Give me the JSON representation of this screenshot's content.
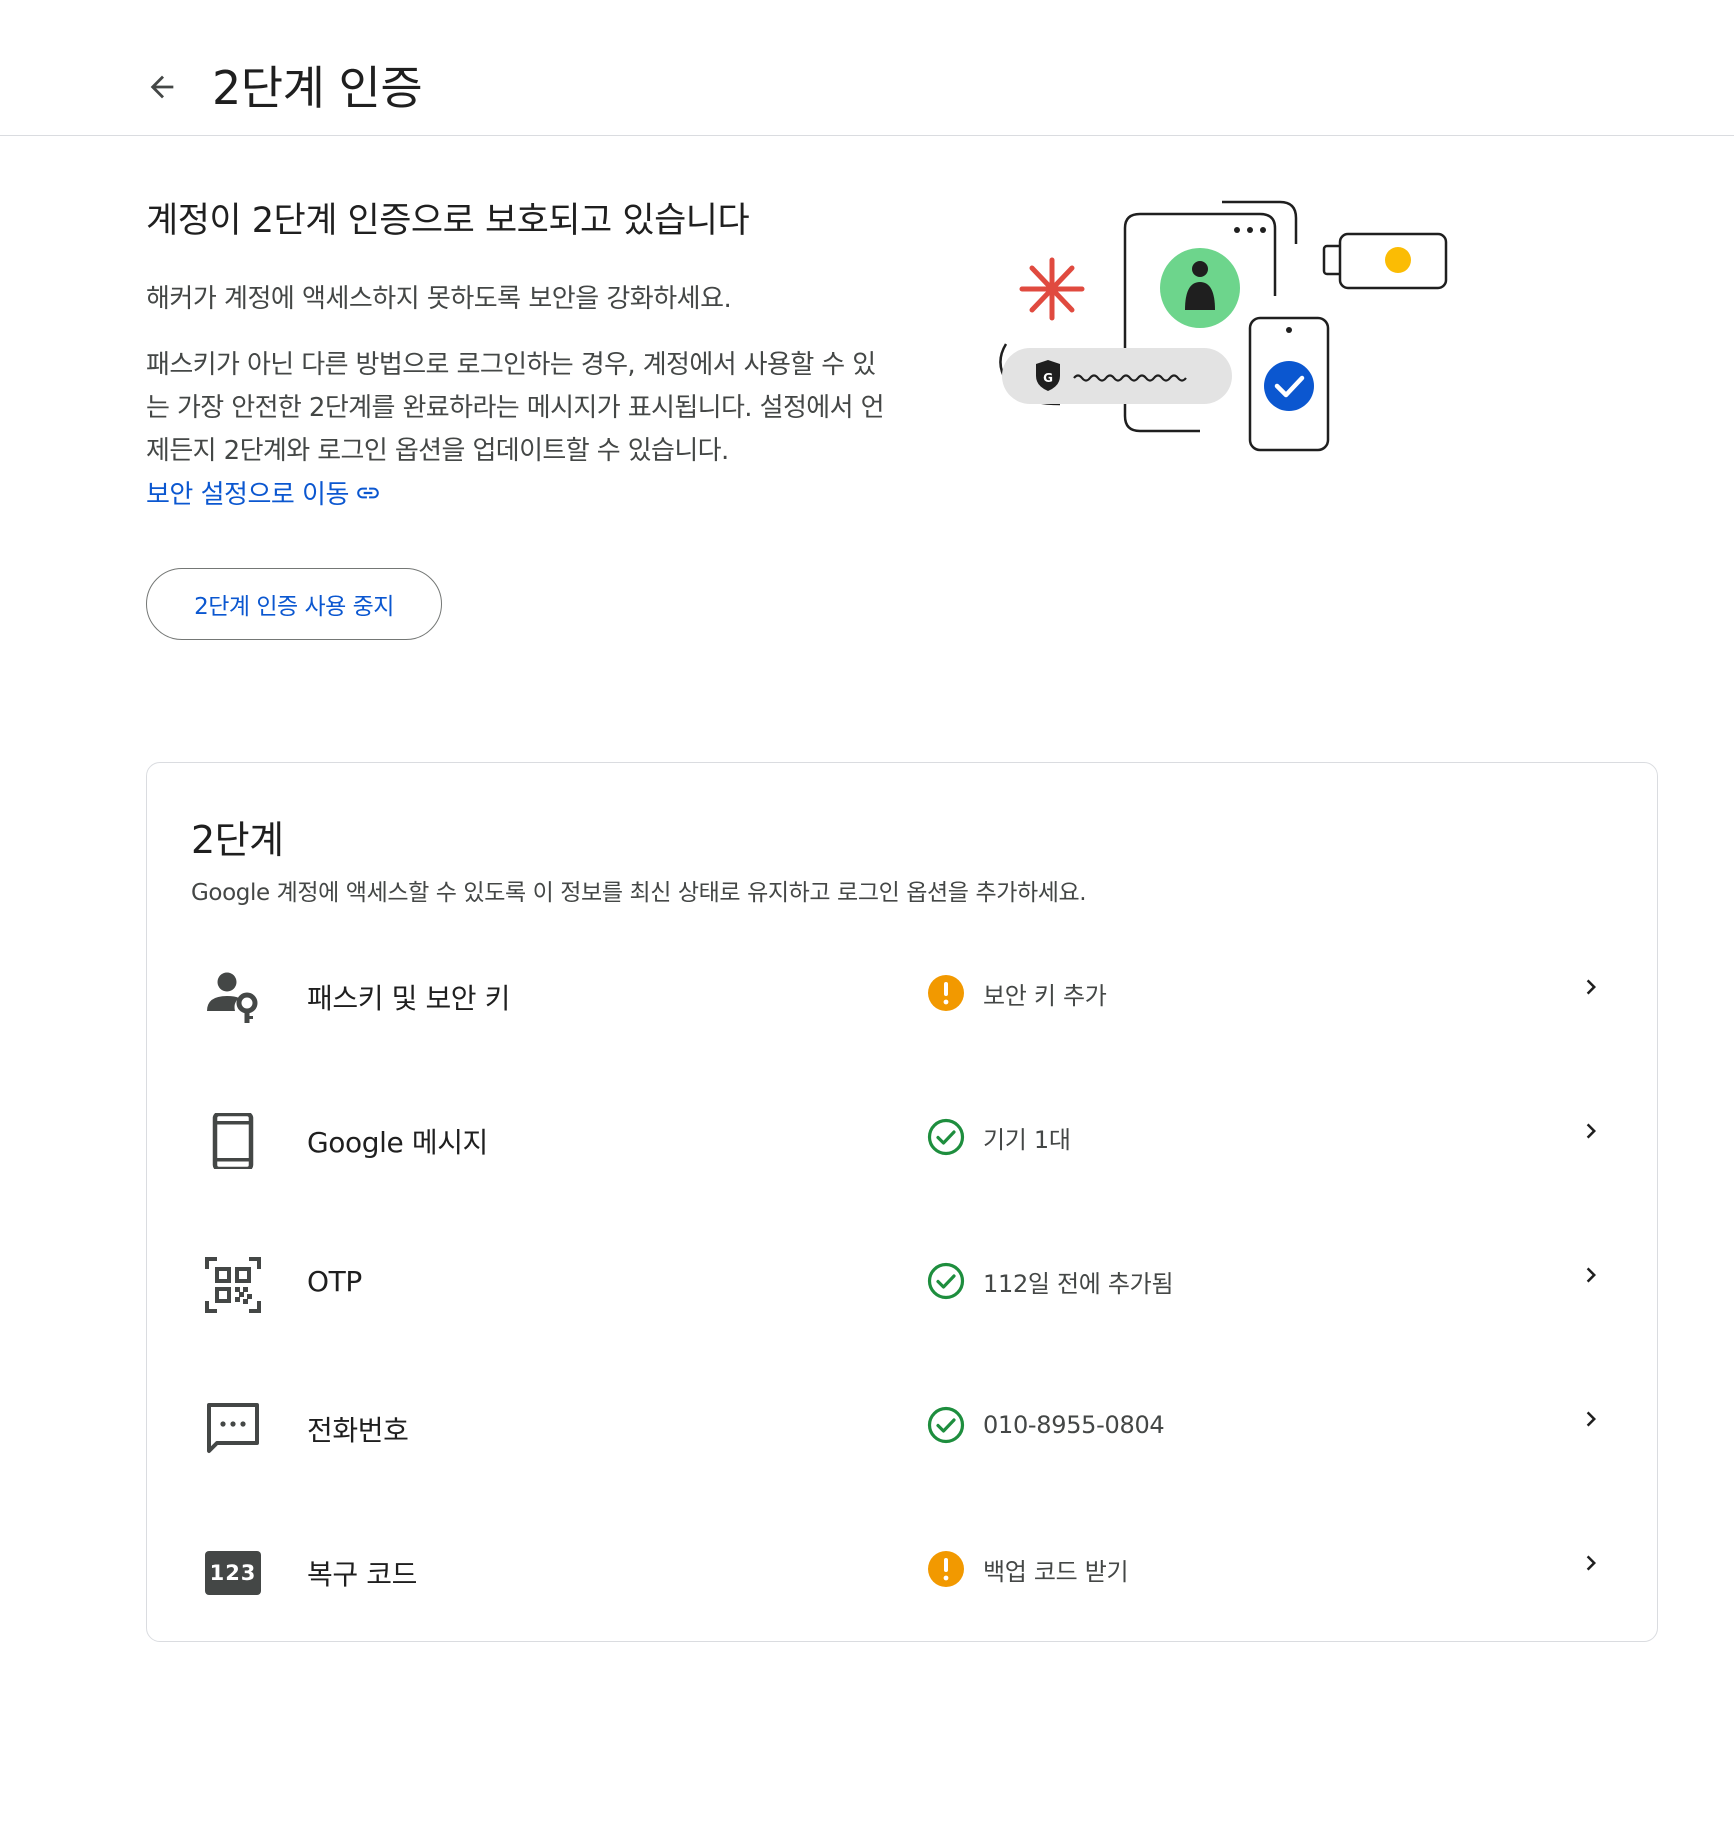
{
  "header": {
    "title": "2단계 인증"
  },
  "hero": {
    "title": "계정이 2단계 인증으로 보호되고 있습니다",
    "subtitle": "해커가 계정에 액세스하지 못하도록 보안을 강화하세요.",
    "paragraph": "패스키가 아닌 다른 방법으로 로그인하는 경우, 계정에서 사용할 수 있는 가장 안전한 2단계를 완료하라는 메시지가 표시됩니다. 설정에서 언제든지 2단계와 로그인 옵션을 업데이트할 수 있습니다.",
    "link_label": "보안 설정으로 이동",
    "disable_button": "2단계 인증 사용 중지"
  },
  "steps_card": {
    "title": "2단계",
    "subtitle": "Google 계정에 액세스할 수 있도록 이 정보를 최신 상태로 유지하고 로그인 옵션을 추가하세요.",
    "items": [
      {
        "label": "패스키 및 보안 키",
        "icon": "person-key-icon",
        "status": "보안 키 추가",
        "status_type": "warning"
      },
      {
        "label": "Google 메시지",
        "icon": "phone-icon",
        "status": "기기 1대",
        "status_type": "ok"
      },
      {
        "label": "OTP",
        "icon": "qr-code-icon",
        "status": "112일 전에 추가됨",
        "status_type": "ok"
      },
      {
        "label": "전화번호",
        "icon": "sms-icon",
        "status": "010-8955-0804",
        "status_type": "ok"
      },
      {
        "label": "복구 코드",
        "icon": "backup-code-icon",
        "icon_text": "123",
        "status": "백업 코드 받기",
        "status_type": "warning"
      }
    ]
  },
  "colors": {
    "accent": "#0b57d0",
    "warning": "#f29900",
    "ok": "#1e8e3e",
    "illus_green": "#6dd58c",
    "illus_red": "#e04a3f",
    "illus_yellow": "#fbbc04"
  }
}
